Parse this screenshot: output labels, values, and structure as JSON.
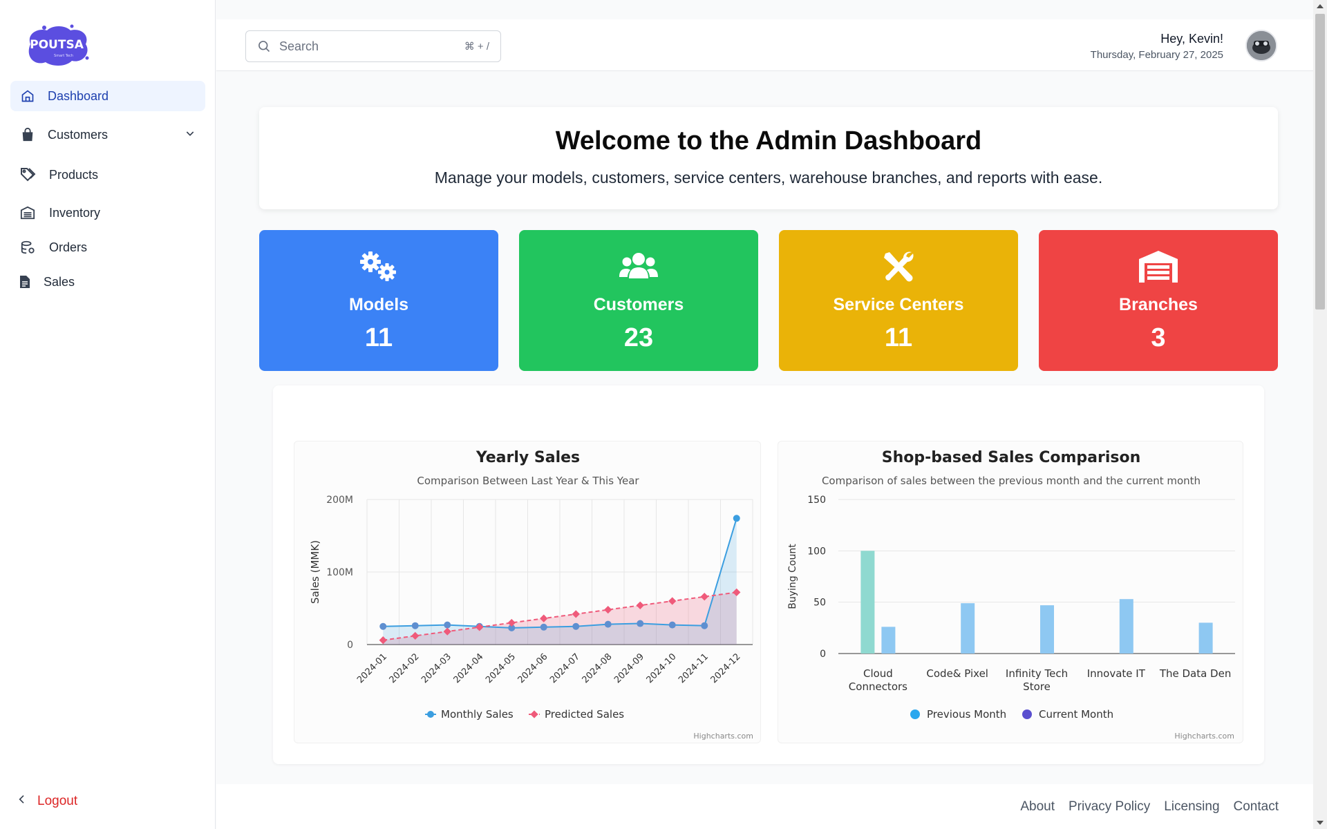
{
  "brand": {
    "logo_text": "POUTSA",
    "logo_sub": "Smart Tech"
  },
  "sidebar": {
    "items": [
      {
        "label": "Dashboard",
        "icon": "home-icon"
      },
      {
        "label": "Customers",
        "icon": "shopping-bag-icon"
      },
      {
        "label": "Products",
        "icon": "tags-icon"
      },
      {
        "label": "Inventory",
        "icon": "warehouse-icon"
      },
      {
        "label": "Orders",
        "icon": "orders-icon"
      },
      {
        "label": "Sales",
        "icon": "document-icon"
      }
    ],
    "logout": "Logout"
  },
  "header": {
    "search_placeholder": "Search",
    "search_shortcut": "⌘ + /",
    "greeting": "Hey, Kevin!",
    "date": "Thursday, February 27, 2025"
  },
  "welcome": {
    "title": "Welcome to the Admin Dashboard",
    "subtitle": "Manage your models, customers, service centers, warehouse branches, and reports with ease."
  },
  "stats": [
    {
      "label": "Models",
      "value": "11",
      "color": "#3b82f6",
      "icon": "gears-icon"
    },
    {
      "label": "Customers",
      "value": "23",
      "color": "#22c55e",
      "icon": "users-icon"
    },
    {
      "label": "Service Centers",
      "value": "11",
      "color": "#eab308",
      "icon": "tools-icon"
    },
    {
      "label": "Branches",
      "value": "3",
      "color": "#ef4444",
      "icon": "warehouse-icon"
    }
  ],
  "chart_data": [
    {
      "type": "line",
      "title": "Yearly Sales",
      "subtitle": "Comparison Between Last Year & This Year",
      "ylabel": "Sales (MMK)",
      "yticks": [
        "0",
        "100M",
        "200M"
      ],
      "ylim": [
        0,
        200000000
      ],
      "categories": [
        "2024-01",
        "2024-02",
        "2024-03",
        "2024-04",
        "2024-05",
        "2024-06",
        "2024-07",
        "2024-08",
        "2024-09",
        "2024-10",
        "2024-11",
        "2024-12"
      ],
      "series": [
        {
          "name": "Monthly Sales",
          "color": "#3b9ee0",
          "values": [
            25000000,
            26000000,
            27000000,
            25000000,
            23000000,
            24000000,
            25000000,
            28000000,
            29000000,
            27000000,
            26000000,
            174000000
          ]
        },
        {
          "name": "Predicted Sales",
          "color": "#ef5a7a",
          "values": [
            6000000,
            12000000,
            18000000,
            24000000,
            30000000,
            36000000,
            42000000,
            48000000,
            54000000,
            60000000,
            66000000,
            72000000
          ]
        }
      ],
      "credit": "Highcharts.com"
    },
    {
      "type": "bar",
      "title": "Shop-based Sales Comparison",
      "subtitle": "Comparison of sales between the previous month and the current month",
      "ylabel": "Buying Count",
      "yticks": [
        "0",
        "50",
        "100",
        "150"
      ],
      "ylim": [
        0,
        150
      ],
      "categories": [
        "Cloud Connectors",
        "Code& Pixel",
        "Infinity Tech Store",
        "Innovate IT",
        "The Data Den"
      ],
      "series": [
        {
          "name": "Previous Month",
          "color": "#2aa7ee",
          "values": [
            100,
            0,
            0,
            0,
            0
          ]
        },
        {
          "name": "Current Month",
          "color": "#5a4fcf",
          "values": [
            26,
            49,
            47,
            53,
            30
          ]
        }
      ],
      "credit": "Highcharts.com"
    }
  ],
  "footer": {
    "links": [
      "About",
      "Privacy Policy",
      "Licensing",
      "Contact"
    ]
  }
}
